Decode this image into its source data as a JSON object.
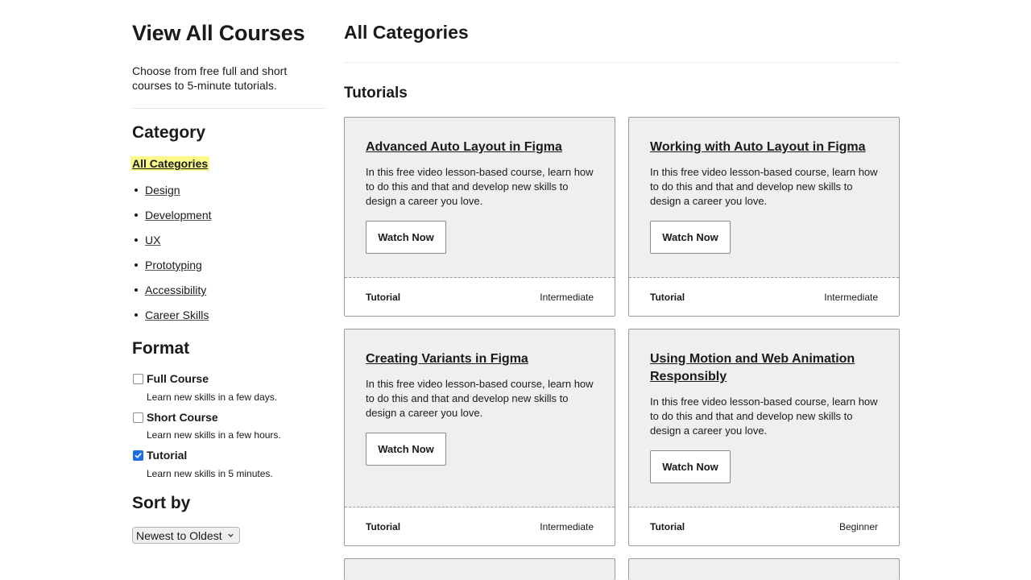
{
  "sidebar": {
    "title": "View All Courses",
    "intro": "Choose from free full and short courses to 5-minute tutorials.",
    "category_heading": "Category",
    "all_categories": "All Categories",
    "categories": [
      "Design",
      "Development",
      "UX",
      "Prototyping",
      "Accessibility",
      "Career Skills"
    ],
    "format_heading": "Format",
    "formats": [
      {
        "label": "Full Course",
        "description": "Learn new skills in a few days.",
        "checked": false
      },
      {
        "label": "Short Course",
        "description": "Learn new skills in a few hours.",
        "checked": false
      },
      {
        "label": "Tutorial",
        "description": "Learn new skills in 5 minutes.",
        "checked": true
      }
    ],
    "sort_heading": "Sort by",
    "sort_selected": "Newest to Oldest"
  },
  "main": {
    "title": "All Categories",
    "section_title": "Tutorials",
    "cards": [
      {
        "title": "Advanced Auto Layout in Figma",
        "description": "In this free video lesson-based course, learn how to do this and that and develop new skills to design a career you love.",
        "button": "Watch Now",
        "type": "Tutorial",
        "level": "Intermediate"
      },
      {
        "title": "Working with Auto Layout in Figma",
        "description": "In this free video lesson-based course, learn how to do this and that and develop new skills to design a career you love.",
        "button": "Watch Now",
        "type": "Tutorial",
        "level": "Intermediate"
      },
      {
        "title": "Creating Variants in Figma",
        "description": "In this free video lesson-based course, learn how to do this and that and develop new skills to design a career you love.",
        "button": "Watch Now",
        "type": "Tutorial",
        "level": "Intermediate"
      },
      {
        "title": "Using Motion and Web Animation Responsibly",
        "description": "In this free video lesson-based course, learn how to do this and that and develop new skills to design a career you love.",
        "button": "Watch Now",
        "type": "Tutorial",
        "level": "Beginner"
      }
    ]
  },
  "colors": {
    "highlight": "#fbf98a",
    "card_background": "#efefef",
    "checkbox_checked": "#1b6fe0"
  }
}
